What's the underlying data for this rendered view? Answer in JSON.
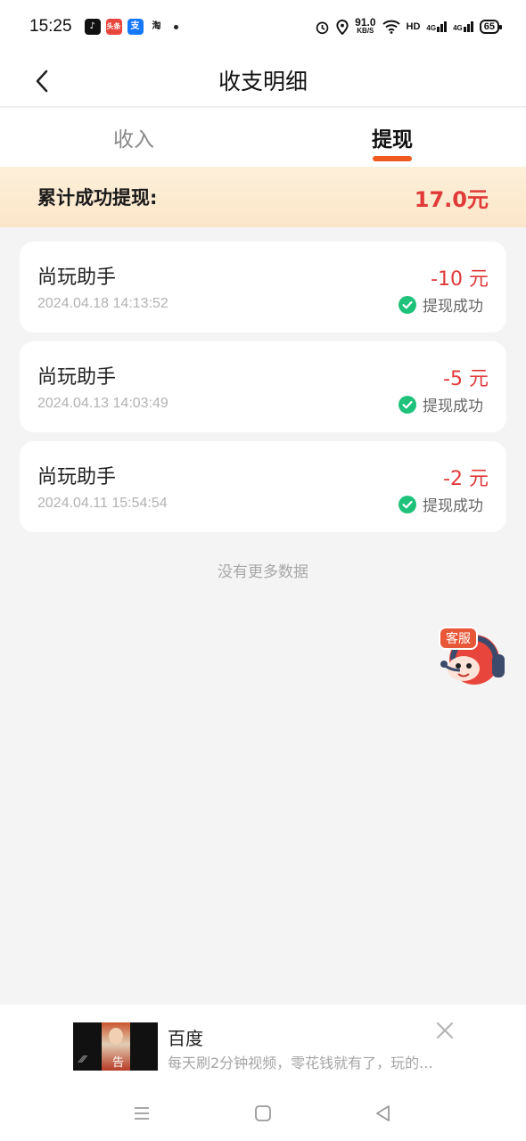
{
  "status_bar": {
    "time": "15:25",
    "apps": [
      {
        "name": "douyin-icon",
        "glyph": "♪",
        "color": "#111111"
      },
      {
        "name": "toutiao-icon",
        "glyph": "头条",
        "color": "#e8453c"
      },
      {
        "name": "alipay-icon",
        "glyph": "支",
        "color": "#1677ff"
      },
      {
        "name": "taobao-icon",
        "glyph": "淘",
        "color": "#ffffff"
      }
    ],
    "speed_value": "91.0",
    "speed_unit": "KB/S",
    "hd_label": "HD",
    "net_label_1": "4G",
    "net_label_2": "4G",
    "battery": "65"
  },
  "header": {
    "title": "收支明细"
  },
  "tabs": [
    {
      "label": "收入",
      "active": false
    },
    {
      "label": "提现",
      "active": true
    }
  ],
  "colors": {
    "accent": "#f05a1f",
    "amount": "#e03a3a",
    "success": "#1ec27a"
  },
  "summary": {
    "label": "累计成功提现:",
    "value": "17.0元"
  },
  "records": [
    {
      "name": "尚玩助手",
      "time": "2024.04.18 14:13:52",
      "amount": "-10 元",
      "status": "提现成功"
    },
    {
      "name": "尚玩助手",
      "time": "2024.04.13 14:03:49",
      "amount": "-5 元",
      "status": "提现成功"
    },
    {
      "name": "尚玩助手",
      "time": "2024.04.11 15:54:54",
      "amount": "-2 元",
      "status": "提现成功"
    }
  ],
  "no_more": "没有更多数据",
  "customer_service": {
    "label": "客服"
  },
  "ad": {
    "title": "百度",
    "description": "每天刷2分钟视频，零花钱就有了，玩的...",
    "thumb_tag": "告"
  }
}
